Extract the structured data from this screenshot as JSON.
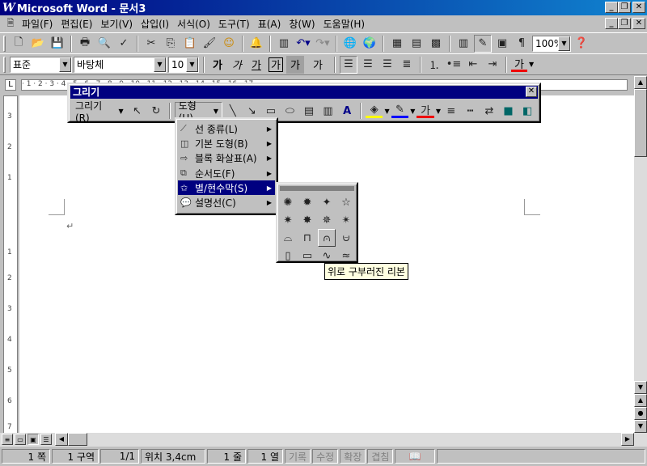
{
  "window": {
    "title": "Microsoft Word - 문서3",
    "logo": "W"
  },
  "menubar": [
    "파일(F)",
    "편집(E)",
    "보기(V)",
    "삽입(I)",
    "서식(O)",
    "도구(T)",
    "표(A)",
    "창(W)",
    "도움말(H)"
  ],
  "standard_toolbar": {
    "zoom": "100%"
  },
  "format_toolbar": {
    "style": "표준",
    "font": "바탕체",
    "size": "10",
    "char_buttons": [
      "가",
      "가",
      "가",
      "가",
      "가",
      "가"
    ]
  },
  "ruler": {
    "marks": "· 1 · 2 · 3 · 4 · 5 · 6 · 7 · 8 · 9 · 10 · 11 · 12 · 13 · 14 · 15 · 16 · 17 ·"
  },
  "vruler": {
    "marks": [
      "3",
      "2",
      "1",
      "1",
      "2",
      "3",
      "4",
      "5",
      "6",
      "7"
    ]
  },
  "draw_toolbar": {
    "title": "그리기",
    "draw_menu": "그리기(R)",
    "autoshape_menu": "도형(U)"
  },
  "autoshape_menu": {
    "items": [
      {
        "label": "선 종류(L)"
      },
      {
        "label": "기본 도형(B)"
      },
      {
        "label": "블록 화살표(A)"
      },
      {
        "label": "순서도(F)"
      },
      {
        "label": "별/현수막(S)"
      },
      {
        "label": "설명선(C)"
      }
    ],
    "selected": "별/현수막(S)"
  },
  "stars_menu": {
    "icons": [
      "explosion-1-icon",
      "explosion-2-icon",
      "star-4-icon",
      "star-5-icon",
      "star-8-icon",
      "star-16-icon",
      "star-24-icon",
      "star-32-icon",
      "ribbon-up-icon",
      "ribbon-down-icon",
      "curved-ribbon-up-icon",
      "curved-ribbon-down-icon",
      "vertical-scroll-icon",
      "horizontal-scroll-icon",
      "wave-icon",
      "double-wave-icon"
    ],
    "glyphs": [
      "✺",
      "✹",
      "✦",
      "☆",
      "✷",
      "✸",
      "✵",
      "✴",
      "⌓",
      "⊓",
      "⩀",
      "⩁",
      "▯",
      "▭",
      "∿",
      "≈"
    ],
    "hovered_index": 10
  },
  "tooltip": {
    "text": "위로 구부러진 리본"
  },
  "status": {
    "page": "1 쪽",
    "section": "1 구역",
    "pages": "1/1",
    "position": "위치 3,4cm",
    "line": "1 줄",
    "col": "1 열",
    "rec": "기록",
    "trk": "수정",
    "ext": "확장",
    "ovr": "겹침"
  }
}
